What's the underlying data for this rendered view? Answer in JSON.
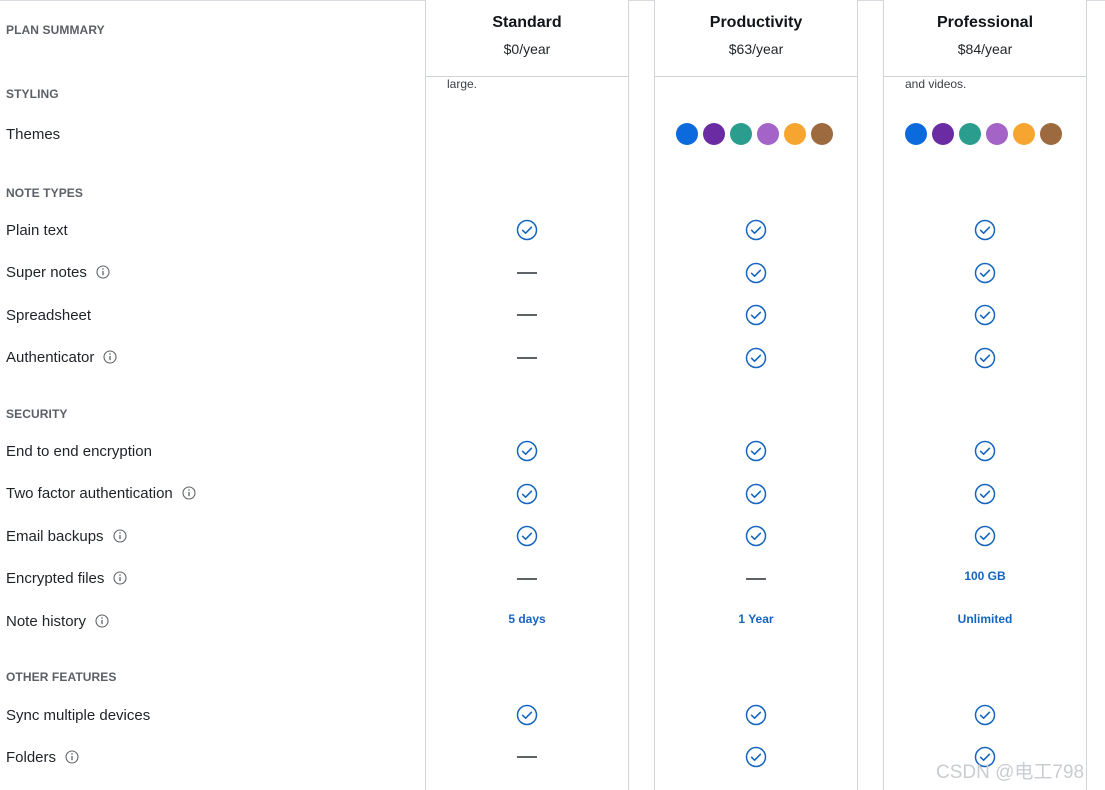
{
  "header": {
    "summary_label": "PLAN SUMMARY"
  },
  "plans": [
    {
      "name": "Standard",
      "price": "$0/year",
      "snippet": "large."
    },
    {
      "name": "Productivity",
      "price": "$63/year",
      "snippet": ""
    },
    {
      "name": "Professional",
      "price": "$84/year",
      "snippet": "and videos."
    }
  ],
  "sections": {
    "styling": "STYLING",
    "note_types": "NOTE TYPES",
    "security": "SECURITY",
    "other": "OTHER FEATURES"
  },
  "features": {
    "themes": "Themes",
    "plain_text": "Plain text",
    "super_notes": "Super notes",
    "spreadsheet": "Spreadsheet",
    "authenticator": "Authenticator",
    "e2e": "End to end encryption",
    "two_factor": "Two factor authentication",
    "email_backups": "Email backups",
    "encrypted_files": "Encrypted files",
    "note_history": "Note history",
    "sync_devices": "Sync multiple devices",
    "folders": "Folders"
  },
  "theme_colors": [
    "#0b6bdc",
    "#6b2ba3",
    "#2a9d8f",
    "#a463c6",
    "#f7a531",
    "#9c6a3e"
  ],
  "values": {
    "encrypted_files": {
      "professional": "100 GB"
    },
    "note_history": {
      "standard": "5 days",
      "productivity": "1 Year",
      "professional": "Unlimited"
    }
  },
  "icons": {
    "check": "check-circle-icon",
    "dash": "not-included-dash",
    "info": "info-icon"
  },
  "colors": {
    "accent": "#1565c0",
    "border": "#d0d3d8",
    "section_label": "#5b5f66"
  },
  "watermark": "CSDN @电工798"
}
